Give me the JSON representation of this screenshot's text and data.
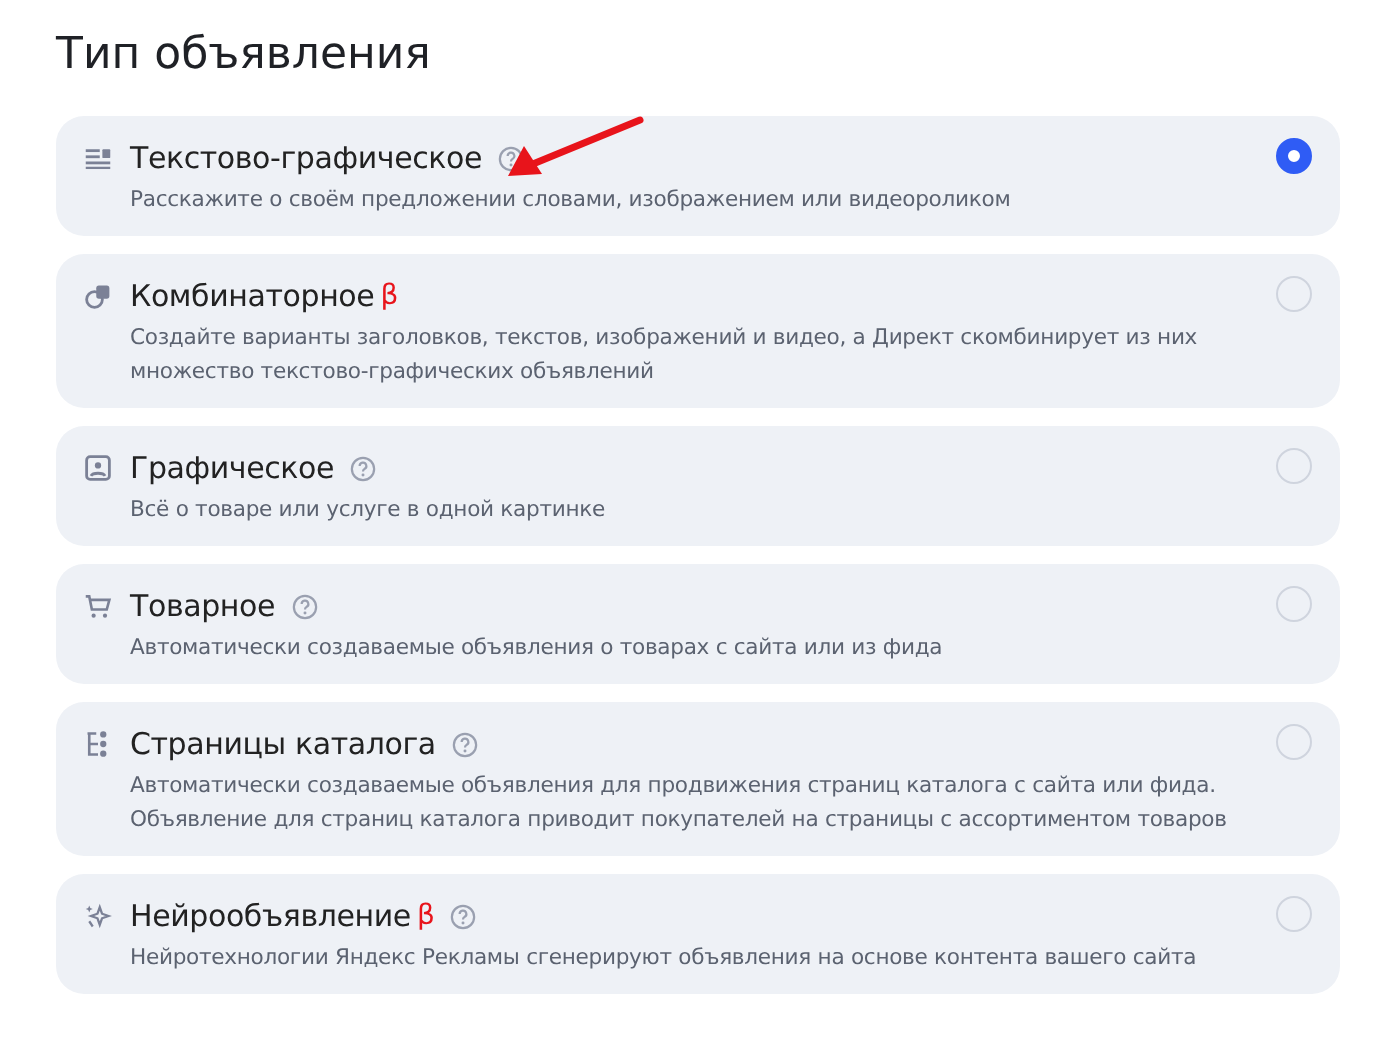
{
  "heading": "Тип объявления",
  "options": [
    {
      "kind": "text-lines",
      "title": "Текстово-графическое",
      "help": true,
      "description": [
        "Расскажите о своём предложении словами, изображением или видеороликом"
      ],
      "selected": true
    },
    {
      "kind": "combine",
      "title": "Комбинаторное",
      "beta": "β",
      "help": false,
      "description": [
        "Создайте варианты заголовков, текстов, изображений и видео, а Директ скомбинирует из них",
        "множество текстово-графических объявлений"
      ],
      "selected": false
    },
    {
      "kind": "image",
      "title": "Графическое",
      "help": true,
      "description": [
        "Всё о товаре или услуге в одной картинке"
      ],
      "selected": false
    },
    {
      "kind": "cart",
      "title": "Товарное",
      "help": true,
      "description": [
        "Автоматически создаваемые объявления о товарах с сайта или из фида"
      ],
      "selected": false
    },
    {
      "kind": "catalog",
      "title": "Страницы каталога",
      "help": true,
      "description": [
        "Автоматически создаваемые объявления для продвижения страниц каталога с сайта или фида.",
        "Объявление для страниц каталога приводит покупателей на страницы с ассортиментом товаров"
      ],
      "selected": false
    },
    {
      "kind": "sparkle",
      "title": "Нейрообъявление",
      "beta": "β",
      "help": true,
      "description": [
        "Нейротехнологии Яндекс Рекламы сгенерируют объявления на основе контента вашего сайта"
      ],
      "selected": false
    }
  ]
}
